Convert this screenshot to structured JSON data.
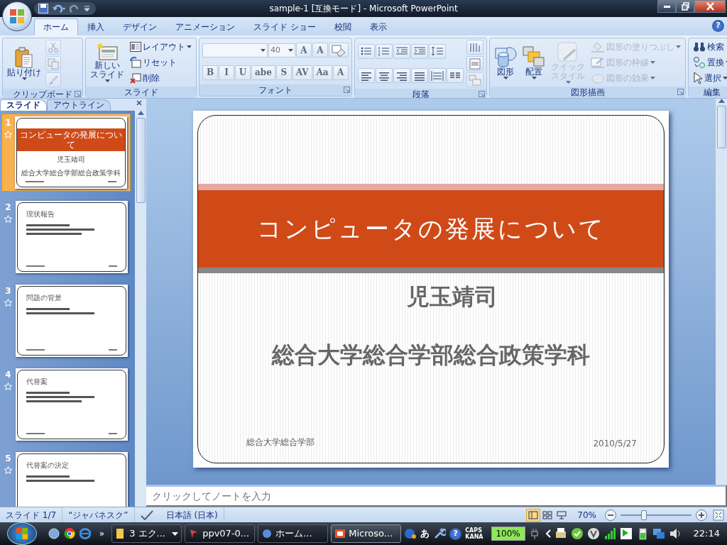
{
  "window": {
    "title": "sample-1 [互換モード] - Microsoft PowerPoint"
  },
  "ribbon_tabs": [
    {
      "label": "ホーム",
      "selected": true
    },
    {
      "label": "挿入",
      "selected": false
    },
    {
      "label": "デザイン",
      "selected": false
    },
    {
      "label": "アニメーション",
      "selected": false
    },
    {
      "label": "スライド ショー",
      "selected": false
    },
    {
      "label": "校閲",
      "selected": false
    },
    {
      "label": "表示",
      "selected": false
    }
  ],
  "help_button": {
    "label": "?"
  },
  "ribbon_groups": [
    {
      "label": "クリップボード",
      "launcher": true,
      "columns": [
        [
          [
            {
              "kind": "large",
              "label": "貼り付け",
              "menu": true,
              "disabled": false
            }
          ]
        ],
        [
          [
            {
              "kind": "icon",
              "disabled": true
            }
          ],
          [
            {
              "kind": "icon",
              "disabled": true
            }
          ],
          [
            {
              "kind": "icon",
              "disabled": true
            }
          ]
        ]
      ]
    },
    {
      "label": "スライド",
      "launcher": false,
      "columns": [
        [
          [
            {
              "kind": "large",
              "label_lines": [
                "新しい",
                "スライド"
              ],
              "menu": true,
              "disabled": false
            }
          ]
        ],
        [
          [
            {
              "kind": "small",
              "label": "レイアウト",
              "menu": true,
              "disabled": false
            }
          ],
          [
            {
              "kind": "small",
              "label": "リセット",
              "menu": false,
              "disabled": false
            }
          ],
          [
            {
              "kind": "small",
              "label": "削除",
              "menu": false,
              "disabled": false
            }
          ]
        ]
      ]
    },
    {
      "label": "フォント",
      "launcher": true,
      "columns": [
        [
          [
            {
              "kind": "field",
              "menu": true
            },
            {
              "kind": "field",
              "value": "40",
              "menu": true
            },
            {
              "kind": "text",
              "label": "A"
            },
            {
              "kind": "text",
              "label": "A"
            },
            {
              "kind": "icon",
              "disabled": false
            }
          ],
          [
            {
              "kind": "text",
              "label": "B"
            },
            {
              "kind": "text",
              "label": "I"
            },
            {
              "kind": "text",
              "label": "U"
            },
            {
              "kind": "text",
              "label": "abe"
            },
            {
              "kind": "text",
              "label": "S"
            },
            {
              "kind": "text",
              "label": "AV"
            },
            {
              "kind": "text",
              "label": "Aa"
            },
            {
              "kind": "text",
              "label": "A"
            }
          ]
        ]
      ]
    },
    {
      "label": "段落",
      "launcher": true,
      "columns": [
        [
          [
            {
              "kind": "icon",
              "disabled": false
            },
            {
              "kind": "icon",
              "disabled": false
            },
            {
              "kind": "icon",
              "disabled": false
            },
            {
              "kind": "icon",
              "disabled": false
            },
            {
              "kind": "icon",
              "disabled": false
            }
          ],
          [
            {
              "kind": "icon",
              "disabled": false
            },
            {
              "kind": "icon",
              "disabled": false
            },
            {
              "kind": "icon",
              "disabled": false
            },
            {
              "kind": "icon",
              "disabled": false
            },
            {
              "kind": "icon",
              "disabled": false
            },
            {
              "kind": "icon",
              "disabled": false
            }
          ]
        ],
        [
          [
            {
              "kind": "icon",
              "disabled": false
            }
          ],
          [
            {
              "kind": "icon",
              "disabled": false
            }
          ],
          [
            {
              "kind": "icon",
              "disabled": true
            }
          ]
        ]
      ]
    },
    {
      "label": "図形描画",
      "launcher": true,
      "columns": [
        [
          [
            {
              "kind": "large",
              "label": "図形",
              "menu": true,
              "disabled": false
            }
          ]
        ],
        [
          [
            {
              "kind": "large",
              "label": "配置",
              "menu": true,
              "disabled": false
            }
          ]
        ],
        [
          [
            {
              "kind": "large",
              "label_lines": [
                "クイック",
                "スタイル"
              ],
              "menu": true,
              "disabled": true
            }
          ]
        ],
        [
          [
            {
              "kind": "small",
              "label": "図形の塗りつぶし",
              "menu": true,
              "disabled": true
            }
          ],
          [
            {
              "kind": "small",
              "label": "図形の枠線",
              "menu": true,
              "disabled": true
            }
          ],
          [
            {
              "kind": "small",
              "label": "図形の効果",
              "menu": true,
              "disabled": true
            }
          ]
        ]
      ]
    },
    {
      "label": "編集",
      "launcher": false,
      "columns": [
        [
          [
            {
              "kind": "small",
              "label": "検索",
              "menu": false,
              "disabled": false
            }
          ],
          [
            {
              "kind": "small",
              "label": "置換",
              "menu": true,
              "disabled": false
            }
          ],
          [
            {
              "kind": "small",
              "label": "選択",
              "menu": true,
              "disabled": false
            }
          ]
        ]
      ]
    }
  ],
  "pane_tabs": [
    {
      "label": "スライド",
      "selected": true
    },
    {
      "label": "アウトライン",
      "selected": false
    }
  ],
  "thumbnails": [
    {
      "number": "1",
      "selected": true,
      "kind": "title",
      "title": "コンピュータの発展について",
      "subtitle": [
        "児玉靖司",
        "総合大学総合学部総合政策学科"
      ]
    },
    {
      "number": "2",
      "selected": false,
      "kind": "content",
      "title": "現状報告"
    },
    {
      "number": "3",
      "selected": false,
      "kind": "content",
      "title": "問題の背景"
    },
    {
      "number": "4",
      "selected": false,
      "kind": "content",
      "title": "代替案"
    },
    {
      "number": "5",
      "selected": false,
      "kind": "content",
      "title": "代替案の決定"
    }
  ],
  "slide": {
    "title": "コンピュータの発展について",
    "subtitle": [
      "児玉靖司",
      "総合大学総合学部総合政策学科"
    ],
    "footer": "総合大学総合学部",
    "date": "2010/5/27"
  },
  "notes": {
    "placeholder": "クリックしてノートを入力"
  },
  "status_bar": {
    "slide": "スライド 1/7",
    "theme": "“ジャパネスク”",
    "language": "日本語 (日本)",
    "views": [
      {
        "selected": true
      },
      {
        "selected": false
      },
      {
        "selected": false
      }
    ],
    "zoom": "70%",
    "zoom_level": {
      "level": 0.33
    }
  },
  "taskbar": {
    "more": "»",
    "tasks": [
      {
        "label": "3 エク...",
        "selected": false,
        "menu": true
      },
      {
        "label": "ppv07-0...",
        "selected": false,
        "menu": false
      },
      {
        "label": "ホーム...",
        "selected": false,
        "menu": false
      },
      {
        "label": "Microso...",
        "selected": true,
        "menu": false
      }
    ],
    "ime": "あ",
    "help": "?",
    "caps": "CAPS",
    "kana": "KANA",
    "battery": "100%",
    "battery_level": {
      "level": 1
    },
    "clock": "22:14"
  }
}
